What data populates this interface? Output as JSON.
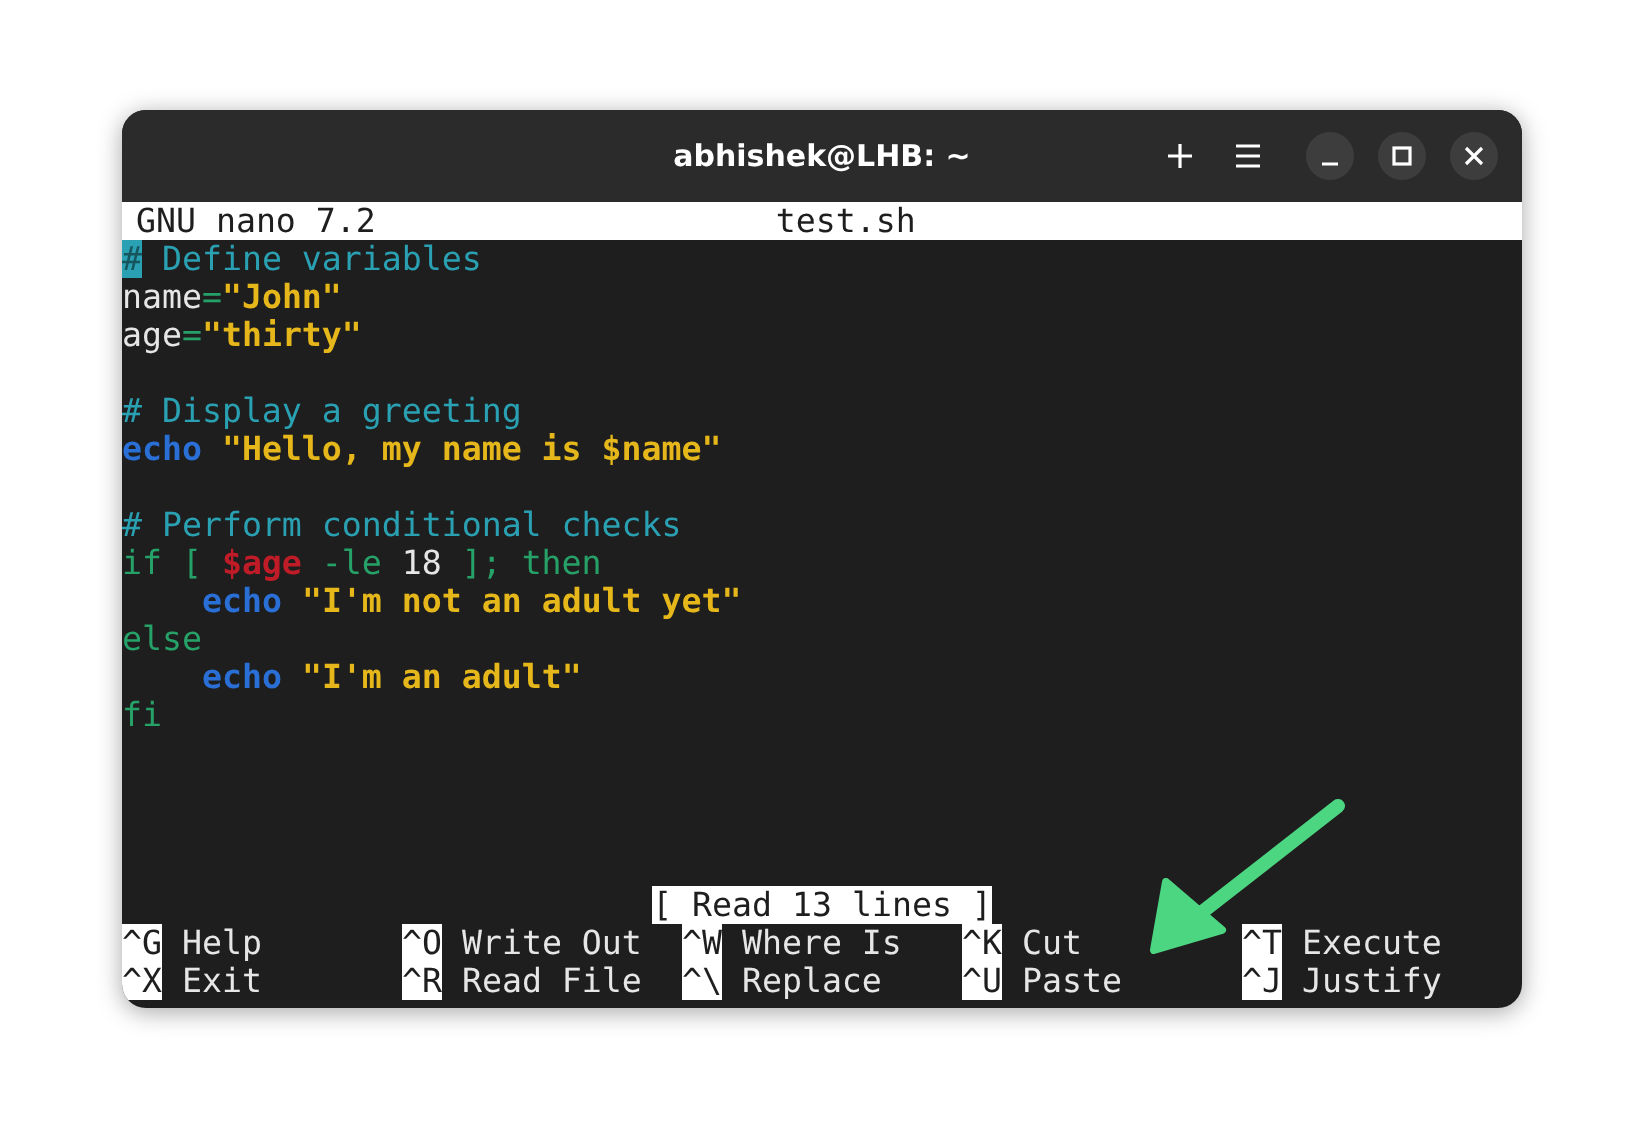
{
  "window": {
    "title": "abhishek@LHB: ~"
  },
  "header": {
    "app": "GNU nano 7.2",
    "file": "test.sh"
  },
  "lines": [
    {
      "tokens": [
        {
          "text": "#",
          "kind": "comment",
          "cursor": true
        },
        {
          "text": " Define variables",
          "kind": "comment"
        }
      ]
    },
    {
      "tokens": [
        {
          "text": "name",
          "kind": "plain"
        },
        {
          "text": "=",
          "kind": "op"
        },
        {
          "text": "\"John\"",
          "kind": "string"
        }
      ]
    },
    {
      "tokens": [
        {
          "text": "age",
          "kind": "plain"
        },
        {
          "text": "=",
          "kind": "op"
        },
        {
          "text": "\"thirty\"",
          "kind": "string"
        }
      ]
    },
    {
      "blank_before": true,
      "tokens": [
        {
          "text": "# Display a greeting",
          "kind": "comment"
        }
      ]
    },
    {
      "tokens": [
        {
          "text": "echo",
          "kind": "builtin"
        },
        {
          "text": " \"Hello, my name is $name\"",
          "kind": "string"
        }
      ]
    },
    {
      "blank_before": true,
      "tokens": [
        {
          "text": "# Perform conditional checks",
          "kind": "comment"
        }
      ]
    },
    {
      "tokens": [
        {
          "text": "if [ ",
          "kind": "op"
        },
        {
          "text": "$age",
          "kind": "variable"
        },
        {
          "text": " -le ",
          "kind": "op"
        },
        {
          "text": "18",
          "kind": "plain"
        },
        {
          "text": " ]; then",
          "kind": "op"
        }
      ]
    },
    {
      "indented": true,
      "tokens": [
        {
          "text": "echo",
          "kind": "builtin"
        },
        {
          "text": " \"I'm not an adult yet\"",
          "kind": "string"
        }
      ]
    },
    {
      "tokens": [
        {
          "text": "else",
          "kind": "op"
        }
      ]
    },
    {
      "indented": true,
      "tokens": [
        {
          "text": "echo",
          "kind": "builtin"
        },
        {
          "text": " \"I'm an adult\"",
          "kind": "string"
        }
      ]
    },
    {
      "tokens": [
        {
          "text": "fi",
          "kind": "op"
        }
      ]
    }
  ],
  "status": "[ Read 13 lines ]",
  "shortcuts": [
    {
      "key": "^G",
      "label": "Help"
    },
    {
      "key": "^O",
      "label": "Write Out"
    },
    {
      "key": "^W",
      "label": "Where Is"
    },
    {
      "key": "^K",
      "label": "Cut"
    },
    {
      "key": "^T",
      "label": "Execute"
    },
    {
      "key": "^X",
      "label": "Exit"
    },
    {
      "key": "^R",
      "label": "Read File"
    },
    {
      "key": "^\\",
      "label": "Replace"
    },
    {
      "key": "^U",
      "label": "Paste"
    },
    {
      "key": "^J",
      "label": "Justify"
    }
  ]
}
